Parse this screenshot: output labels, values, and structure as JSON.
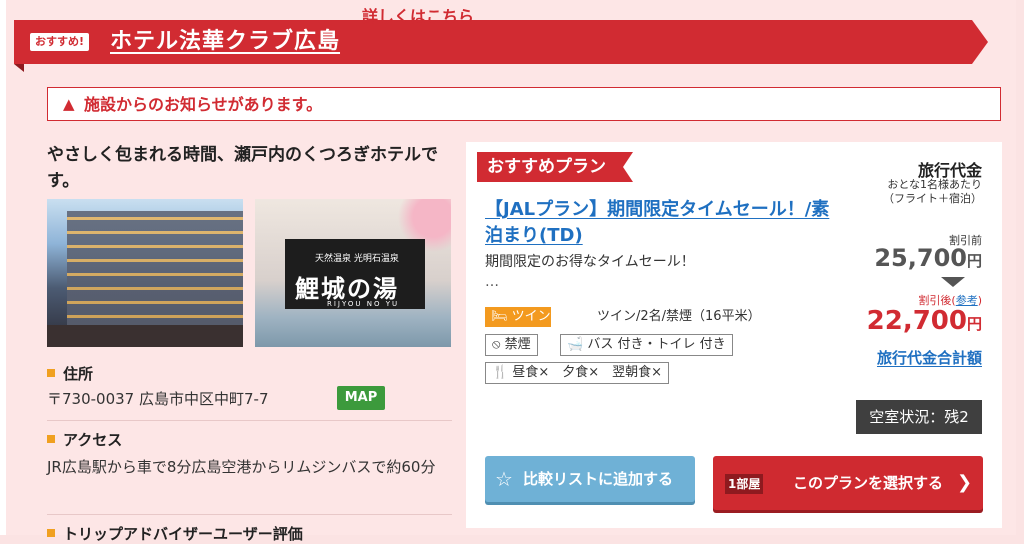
{
  "header": {
    "badge": "おすすめ!",
    "hotel_name": "ホテル法華クラブ広島"
  },
  "notice": {
    "icon": "warning-icon",
    "text": "施設からのお知らせがあります。",
    "link": "詳しくはこちら"
  },
  "catchcopy": "やさしく包まれる時間、瀬戸内のくつろぎホテルです。",
  "photos": {
    "bath_caption_small": "天然温泉 光明石温泉",
    "bath_caption_main": "鯉城の湯",
    "bath_caption_roman": "RIJYOU NO YU"
  },
  "address": {
    "label": "住所",
    "value": "〒730-0037 広島市中区中町7-7",
    "map_button": "MAP"
  },
  "access": {
    "label": "アクセス",
    "value": "JR広島駅から車で8分広島空港からリムジンバスで約60分"
  },
  "next_section": {
    "label": "トリップアドバイザーユーザー評価"
  },
  "plan": {
    "tag": "おすすめプラン",
    "title": "【JALプラン】期間限定タイムセール！/素泊まり(TD)",
    "description": "期間限定のお得なタイムセール！",
    "ellipsis": "…",
    "room_type": "ツイン",
    "room_spec": "ツイン/2名/禁煙（16平米）",
    "chips": {
      "smoking": "禁煙",
      "bath": "バス 付き・トイレ 付き",
      "meals": "昼食×　夕食×　翌朝食×"
    },
    "price": {
      "heading": "旅行代金",
      "sub1": "おとな1名様あたり",
      "sub2": "（フライト＋宿泊）",
      "before_label": "割引前",
      "before_value": "25,700",
      "after_label": "割引後(",
      "after_ref": "参考",
      "after_label_end": ")",
      "after_value": "22,700",
      "yen": "円",
      "total_link": "旅行代金合計額"
    },
    "vacancy": "空室状況：残2",
    "compare_button": "比較リストに追加する",
    "rooms_badge": "1部屋",
    "select_button": "このプランを選択する",
    "select_chevron": "❯"
  },
  "colors": {
    "brand_red": "#d12b32",
    "link_blue": "#1f70c1",
    "room_orange": "#f39a1f",
    "map_green": "#3c9a3c",
    "compare_blue": "#6fb1d6"
  }
}
